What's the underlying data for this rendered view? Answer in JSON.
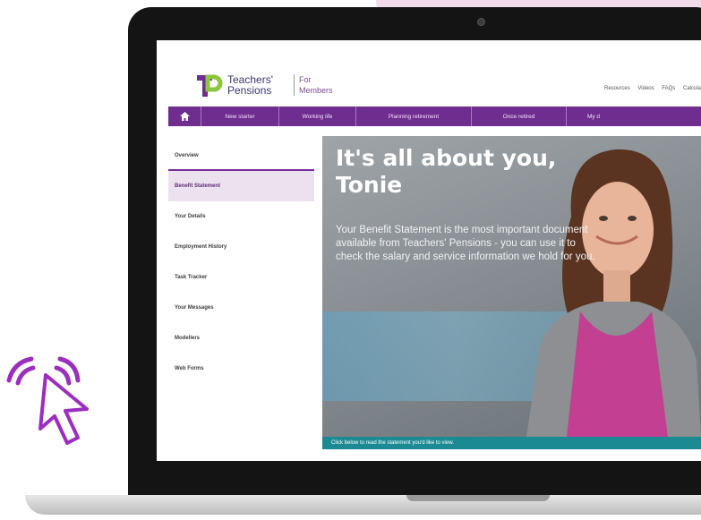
{
  "colors": {
    "brand_purple": "#6e2d8f",
    "caption_teal": "#1c8a93",
    "cursor_purple": "#9b2dbf",
    "accent_pink": "#f2dce9"
  },
  "logo": {
    "line1": "Teachers'",
    "line2": "Pensions",
    "sub1": "For",
    "sub2": "Members"
  },
  "top_links": [
    "Resources",
    "Videos",
    "FAQs",
    "Calcula"
  ],
  "nav": {
    "home_icon": "home-icon",
    "items": [
      "New starter",
      "Working life",
      "Planning retirement",
      "Once retired",
      "My d"
    ]
  },
  "sidebar": {
    "items": [
      "Overview",
      "Benefit Statement",
      "Your Details",
      "Employment History",
      "Task Tracker",
      "Your Messages",
      "Modellers",
      "Web Forms"
    ]
  },
  "hero": {
    "title_line1": "It's all about you,",
    "title_line2": "Tonie",
    "body": "Your Benefit Statement is the most important document available from Teachers' Pensions - you can use it to check the salary and service information we hold for you."
  },
  "caption": "Click below to read the statement you'd like to view.",
  "cursor_icon": "click-cursor-icon"
}
